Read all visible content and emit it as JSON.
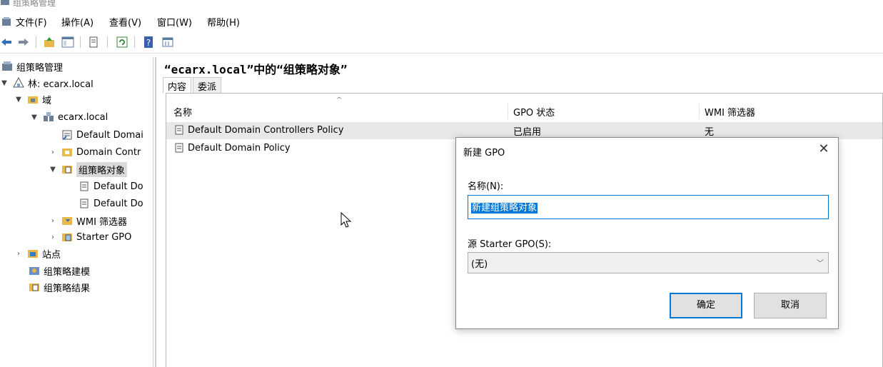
{
  "window": {
    "title": "组策略管理"
  },
  "menu": {
    "items": [
      "文件(F)",
      "操作(A)",
      "查看(V)",
      "窗口(W)",
      "帮助(H)"
    ]
  },
  "toolbar": {
    "icons": [
      "back-arrow-icon",
      "forward-arrow-icon",
      "up-folder-icon",
      "show-hide-tree-icon",
      "properties-icon",
      "refresh-icon",
      "help-icon",
      "console-icon"
    ]
  },
  "tree": {
    "root": "组策略管理",
    "forest": "林: ecarx.local",
    "domains": "域",
    "domain": "ecarx.local",
    "default_domain_policy": "Default Domai",
    "domain_controllers": "Domain Contr",
    "gpo_container": "组策略对象",
    "gpo_child_1": "Default Do",
    "gpo_child_2": "Default Do",
    "wmi_filters": "WMI 筛选器",
    "starter_gpo": "Starter GPO",
    "sites": "站点",
    "modeling": "组策略建模",
    "results": "组策略结果"
  },
  "content": {
    "title": "“ecarx.local”中的“组策略对象”",
    "tabs": [
      "内容",
      "委派"
    ],
    "columns": [
      "名称",
      "GPO 状态",
      "WMI 筛选器"
    ],
    "rows": [
      {
        "name": "Default Domain Controllers Policy",
        "status": "已启用",
        "wmi": "无"
      },
      {
        "name": "Default Domain Policy",
        "status": "",
        "wmi": ""
      }
    ]
  },
  "dialog": {
    "title": "新建 GPO",
    "name_label": "名称(N):",
    "name_value": "新建组策略对象",
    "starter_label": "源 Starter GPO(S):",
    "starter_value": "(无)",
    "ok_label": "确定",
    "cancel_label": "取消"
  },
  "colors": {
    "accent": "#0078d7",
    "selection": "#0078d7"
  }
}
